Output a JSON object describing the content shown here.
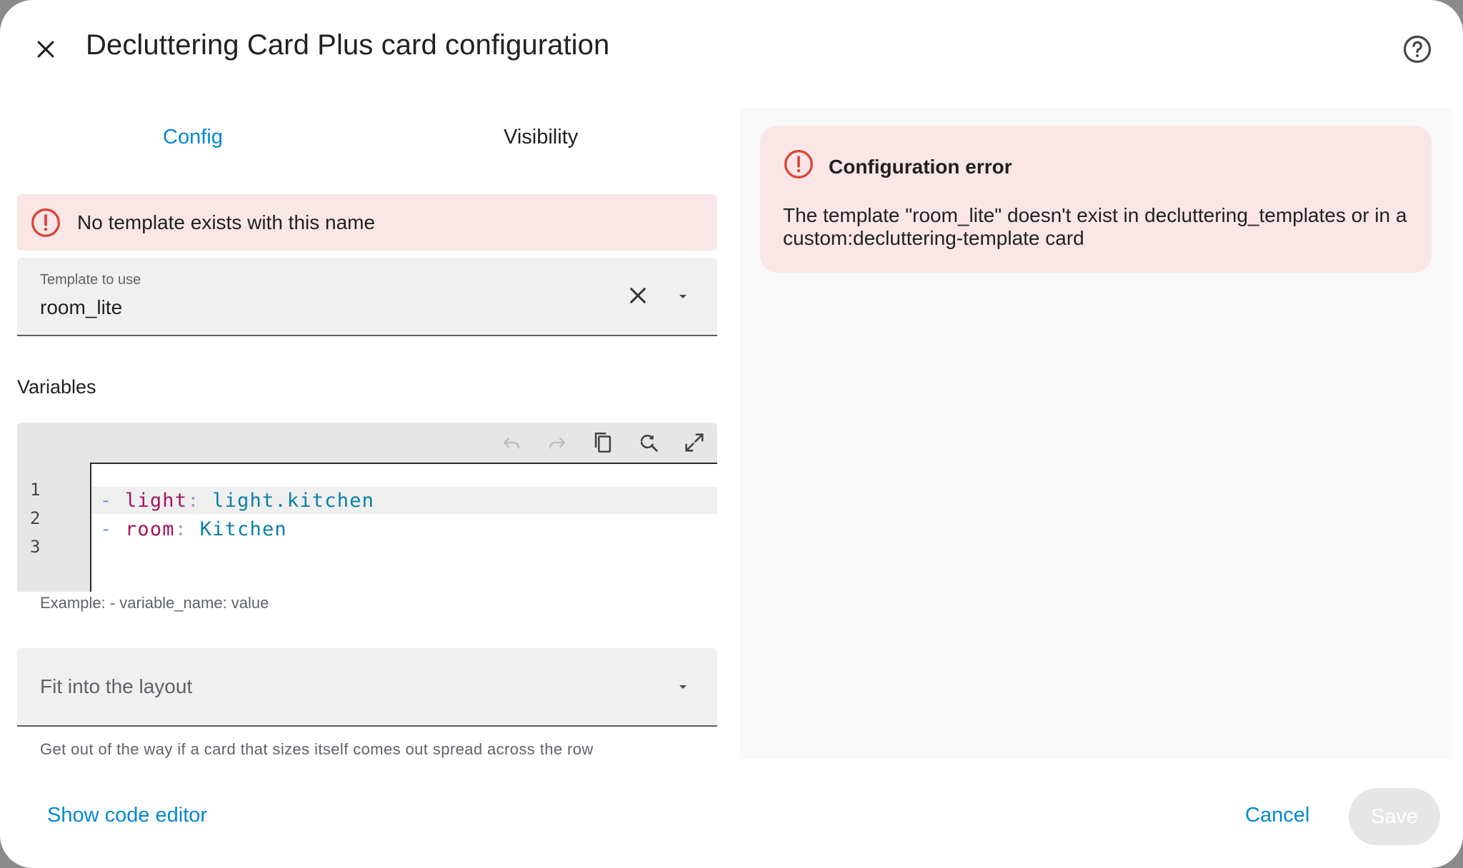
{
  "dialog": {
    "title": "Decluttering Card Plus card configuration",
    "close_icon": "close-icon",
    "help_icon": "help-circle-icon"
  },
  "tabs": [
    {
      "label": "Config",
      "active": true
    },
    {
      "label": "Visibility",
      "active": false
    }
  ],
  "alert": {
    "icon": "alert-circle-icon",
    "text": "No template exists with this name"
  },
  "template_field": {
    "label": "Template to use",
    "value": "room_lite",
    "clear_icon": "close-icon",
    "dropdown_icon": "arrow-drop-down-icon"
  },
  "variables": {
    "heading": "Variables",
    "toolbar_icons": [
      "undo-icon",
      "redo-icon",
      "copy-icon",
      "search-replace-icon",
      "fullscreen-icon"
    ],
    "line_numbers": [
      "1",
      "2",
      "3"
    ],
    "lines": [
      {
        "dash": "-",
        "key": "light",
        "colon": ":",
        "value": "light.kitchen"
      },
      {
        "dash": "-",
        "key": "room",
        "colon": ":",
        "value": "Kitchen"
      }
    ],
    "helper": "Example: - variable_name: value"
  },
  "layout_field": {
    "value": "Fit into the layout",
    "helper": "Get out of the way if a card that sizes itself comes out spread across the row"
  },
  "preview": {
    "error_title": "Configuration error",
    "error_message": "The template \"room_lite\" doesn't exist in decluttering_templates or in a custom:decluttering-template card"
  },
  "footer": {
    "show_code_editor": "Show code editor",
    "cancel": "Cancel",
    "save": "Save"
  },
  "colors": {
    "accent": "#0288d1",
    "error": "#db4437",
    "error_bg": "#fae6e6"
  }
}
